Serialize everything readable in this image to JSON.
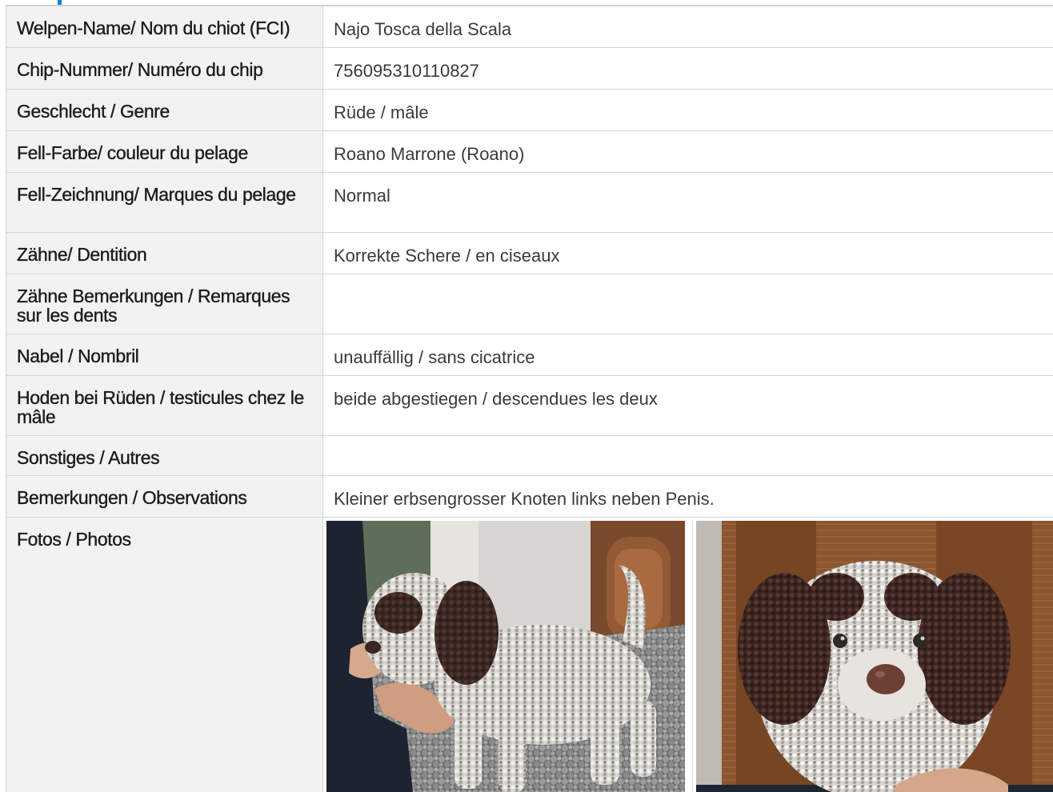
{
  "rows": [
    {
      "label": "Welpen-Name/ Nom du chiot (FCI)",
      "value": "Najo Tosca della Scala"
    },
    {
      "label": "Chip-Nummer/ Numéro du chip",
      "value": "756095310110827"
    },
    {
      "label": "Geschlecht / Genre",
      "value": "Rüde / mâle"
    },
    {
      "label": "Fell-Farbe/ couleur du pelage",
      "value": "Roano Marrone (Roano)"
    },
    {
      "label": "Fell-Zeichnung/ Marques du pelage",
      "value": "Normal"
    },
    {
      "label": "Zähne/ Dentition",
      "value": "Korrekte Schere / en ciseaux"
    },
    {
      "label": "Zähne Bemerkungen / Remarques sur les dents",
      "value": ""
    },
    {
      "label": "Nabel / Nombril",
      "value": "unauffällig / sans cicatrice"
    },
    {
      "label": "Hoden bei Rüden / testicules chez le mâle",
      "value": "beide abgestiegen / descendues les deux"
    },
    {
      "label": "Sonstiges / Autres",
      "value": ""
    },
    {
      "label": "Bemerkungen / Observations",
      "value": "Kleiner erbsengrosser Knoten links neben Penis."
    },
    {
      "label": "Fotos / Photos",
      "value": ""
    }
  ],
  "photos": [
    {
      "subject": "puppy-standing-side-view"
    },
    {
      "subject": "puppy-face-portrait"
    }
  ],
  "colors": {
    "accent": "#0a84d8",
    "label_bg": "#f2f2f2",
    "border": "#d5d5d5"
  }
}
